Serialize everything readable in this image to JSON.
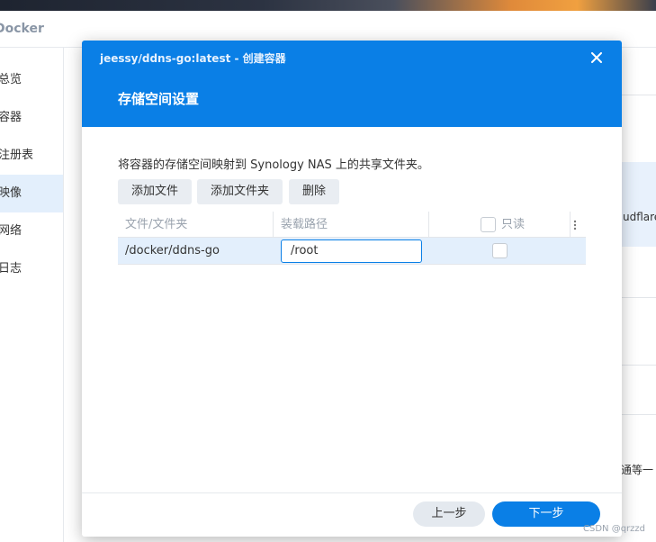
{
  "background": {
    "app_title": "Docker",
    "sidebar": [
      {
        "label": "总览"
      },
      {
        "label": "容器"
      },
      {
        "label": "注册表"
      },
      {
        "label": "映像"
      },
      {
        "label": "网络"
      },
      {
        "label": "日志"
      }
    ],
    "right_text_1": "udflare",
    "right_text_2": "通等一"
  },
  "modal": {
    "subtitle": "jeessy/ddns-go:latest - 创建容器",
    "title": "存储空间设置",
    "description": "将容器的存储空间映射到 Synology NAS 上的共享文件夹。",
    "buttons": {
      "add_file": "添加文件",
      "add_folder": "添加文件夹",
      "delete": "删除"
    },
    "table": {
      "columns": {
        "file_folder": "文件/文件夹",
        "mount_path": "装载路径",
        "read_only": "只读"
      },
      "rows": [
        {
          "file_folder": "/docker/ddns-go",
          "mount_path": "/root",
          "read_only": false
        }
      ]
    },
    "footer": {
      "prev": "上一步",
      "next": "下一步"
    }
  },
  "watermark": "CSDN @qrzzd",
  "colors": {
    "accent": "#0a7fe6",
    "row_highlight": "#e3effc"
  }
}
